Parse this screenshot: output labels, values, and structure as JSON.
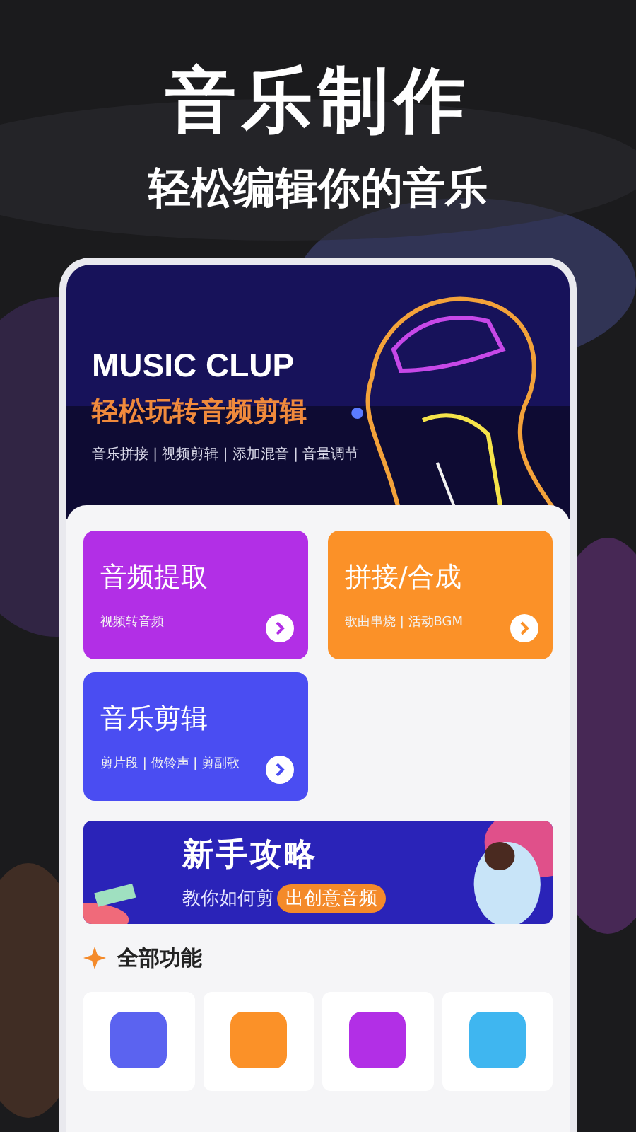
{
  "headline": {
    "title": "音乐制作",
    "subtitle": "轻松编辑你的音乐"
  },
  "banner": {
    "brand": "MUSIC CLUP",
    "slogan": "轻松玩转音频剪辑",
    "features": "音乐拼接 | 视频剪辑 | 添加混音 | 音量调节"
  },
  "tools": [
    {
      "title": "音频提取",
      "desc": "视频转音频",
      "color": "#b22fe6"
    },
    {
      "title": "拼接/合成",
      "desc": "歌曲串烧 | 活动BGM",
      "color": "#fb9128"
    },
    {
      "title": "音乐剪辑",
      "desc": "剪片段 | 做铃声 | 剪副歌",
      "color": "#4a4df2"
    }
  ],
  "guide": {
    "title": "新手攻略",
    "lead": "教你如何剪",
    "highlight": "出创意音频"
  },
  "section": {
    "title": "全部功能"
  },
  "feature_tiles": [
    {
      "color": "#5b63f0"
    },
    {
      "color": "#fb9128"
    },
    {
      "color": "#b22fe6"
    },
    {
      "color": "#3fb6f0"
    }
  ]
}
